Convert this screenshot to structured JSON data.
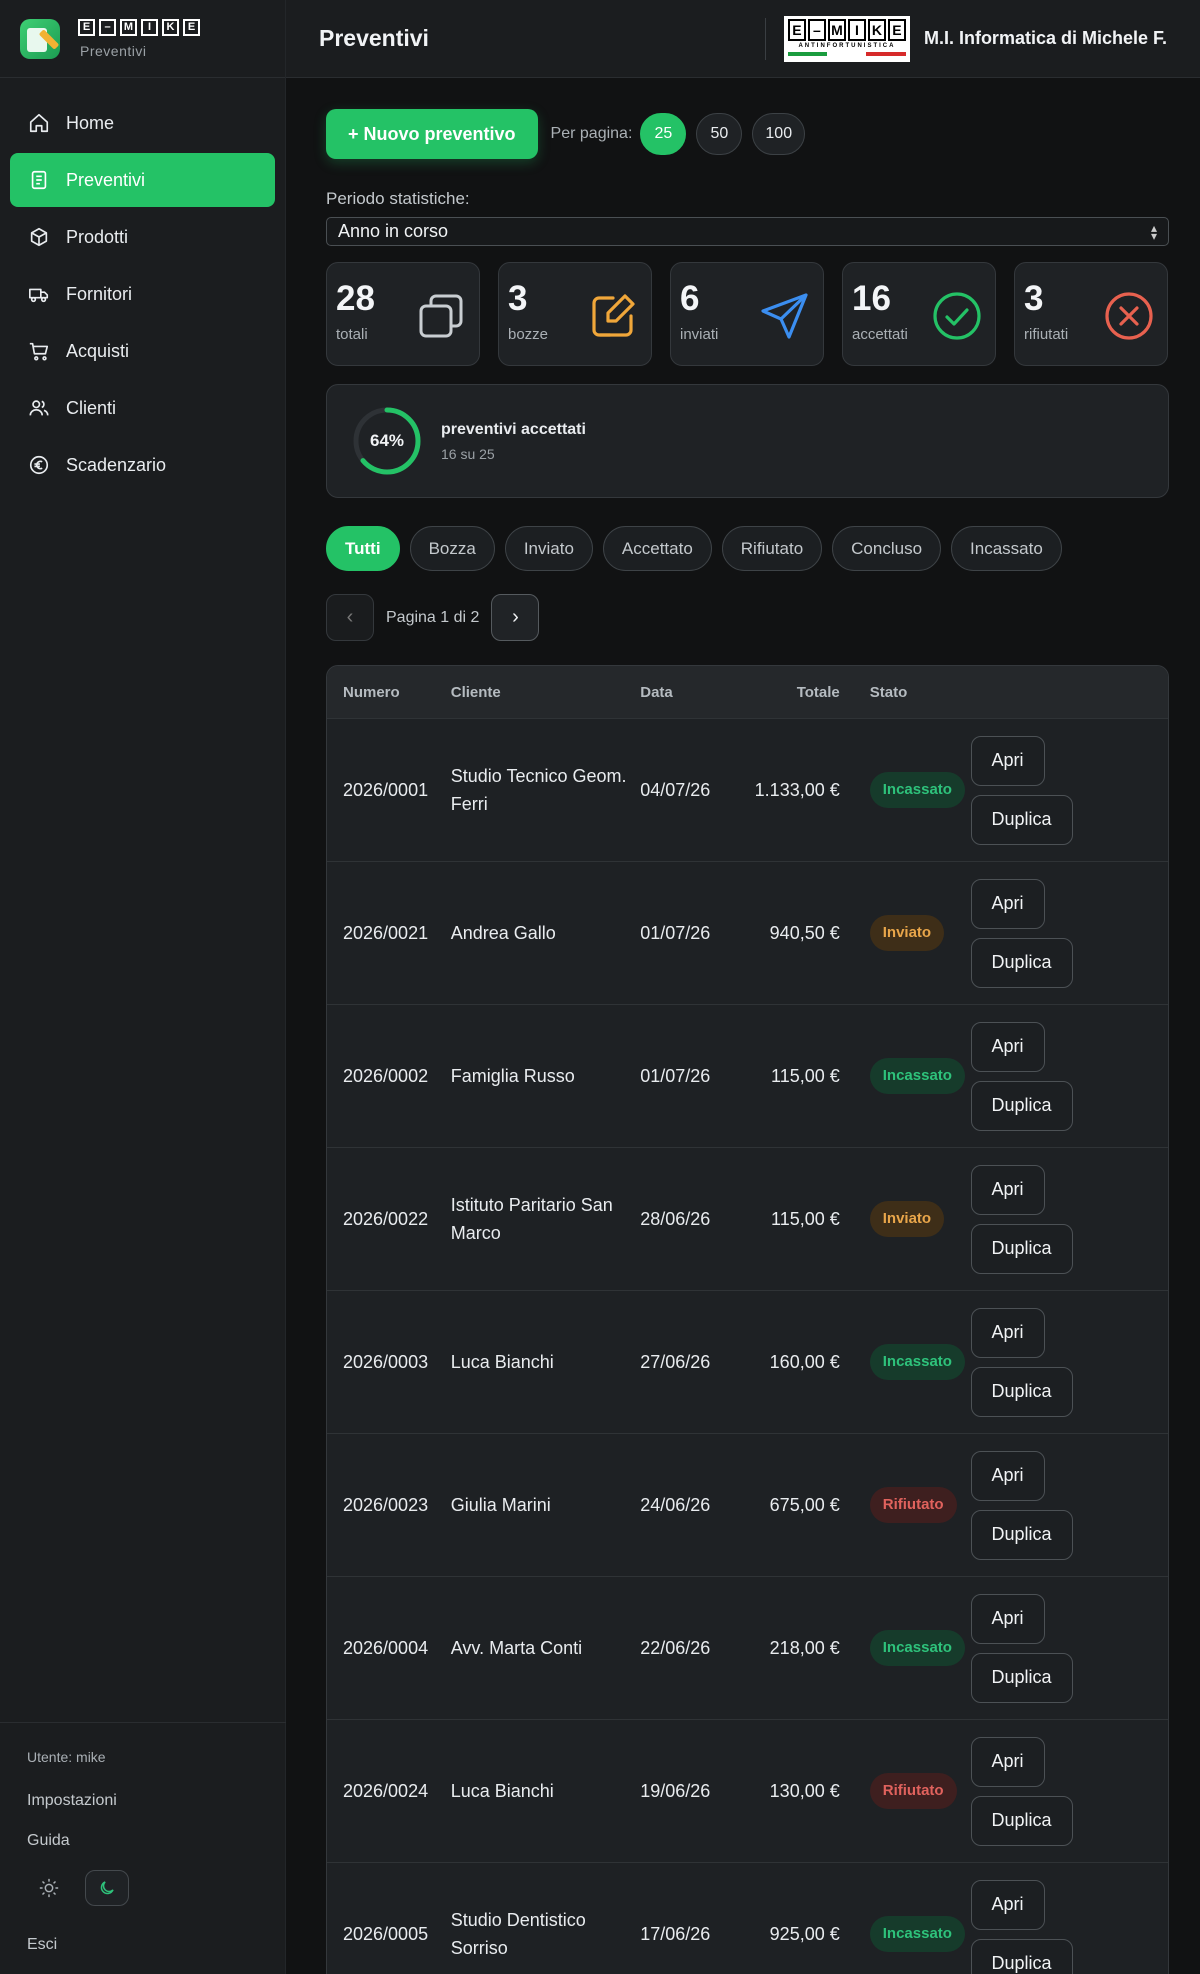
{
  "brand": {
    "logo_letters": [
      "E",
      "–",
      "M",
      "I",
      "K",
      "E"
    ],
    "app_name": "Preventivi"
  },
  "nav": [
    {
      "label": "Home",
      "icon": "home-icon",
      "active": false
    },
    {
      "label": "Preventivi",
      "icon": "document-icon",
      "active": true
    },
    {
      "label": "Prodotti",
      "icon": "box-icon",
      "active": false
    },
    {
      "label": "Fornitori",
      "icon": "truck-icon",
      "active": false
    },
    {
      "label": "Acquisti",
      "icon": "cart-icon",
      "active": false
    },
    {
      "label": "Clienti",
      "icon": "users-icon",
      "active": false
    },
    {
      "label": "Scadenzario",
      "icon": "euro-icon",
      "active": false
    }
  ],
  "footer": {
    "user": "Utente: mike",
    "settings": "Impostazioni",
    "guide": "Guida",
    "logout": "Esci"
  },
  "header": {
    "title": "Preventivi",
    "company_logo_letters": [
      "E",
      "–",
      "M",
      "I",
      "K",
      "E"
    ],
    "company_logo_tagline": "ANTINFORTUNISTICA",
    "company_name": "M.I. Informatica di Michele F."
  },
  "toolbar": {
    "new_label": "+ Nuovo preventivo",
    "per_page_label": "Per pagina:",
    "per_page_options": [
      "25",
      "50",
      "100"
    ],
    "per_page_selected": "25"
  },
  "period": {
    "label": "Periodo statistiche:",
    "value": "Anno in corso"
  },
  "stats": [
    {
      "value": "28",
      "label": "totali",
      "icon": "copy-icon",
      "color": "#c9ced2"
    },
    {
      "value": "3",
      "label": "bozze",
      "icon": "edit-icon",
      "color": "#f0a73a"
    },
    {
      "value": "6",
      "label": "inviati",
      "icon": "send-icon",
      "color": "#3b8ef0"
    },
    {
      "value": "16",
      "label": "accettati",
      "icon": "check-circle-icon",
      "color": "#24c266"
    },
    {
      "value": "3",
      "label": "rifiutati",
      "icon": "x-circle-icon",
      "color": "#e8614f"
    }
  ],
  "progress": {
    "percent": 64,
    "percent_label": "64%",
    "title": "preventivi accettati",
    "subtitle": "16 su 25",
    "color": "#24c266"
  },
  "filters": [
    "Tutti",
    "Bozza",
    "Inviato",
    "Accettato",
    "Rifiutato",
    "Concluso",
    "Incassato"
  ],
  "active_filter": "Tutti",
  "pager": {
    "label": "Pagina 1 di 2"
  },
  "table": {
    "columns": {
      "numero": "Numero",
      "cliente": "Cliente",
      "data": "Data",
      "totale": "Totale",
      "stato": "Stato"
    },
    "open_label": "Apri",
    "duplicate_label": "Duplica",
    "rows": [
      {
        "numero": "2026/0001",
        "cliente": "Studio Tecnico Geom. Ferri",
        "data": "04/07/26",
        "totale": "1.133,00 €",
        "stato": "Incassato"
      },
      {
        "numero": "2026/0021",
        "cliente": "Andrea Gallo",
        "data": "01/07/26",
        "totale": "940,50 €",
        "stato": "Inviato"
      },
      {
        "numero": "2026/0002",
        "cliente": "Famiglia Russo",
        "data": "01/07/26",
        "totale": "115,00 €",
        "stato": "Incassato"
      },
      {
        "numero": "2026/0022",
        "cliente": "Istituto Paritario San Marco",
        "data": "28/06/26",
        "totale": "115,00 €",
        "stato": "Inviato"
      },
      {
        "numero": "2026/0003",
        "cliente": "Luca Bianchi",
        "data": "27/06/26",
        "totale": "160,00 €",
        "stato": "Incassato"
      },
      {
        "numero": "2026/0023",
        "cliente": "Giulia Marini",
        "data": "24/06/26",
        "totale": "675,00 €",
        "stato": "Rifiutato"
      },
      {
        "numero": "2026/0004",
        "cliente": "Avv. Marta Conti",
        "data": "22/06/26",
        "totale": "218,00 €",
        "stato": "Incassato"
      },
      {
        "numero": "2026/0024",
        "cliente": "Luca Bianchi",
        "data": "19/06/26",
        "totale": "130,00 €",
        "stato": "Rifiutato"
      },
      {
        "numero": "2026/0005",
        "cliente": "Studio Dentistico Sorriso",
        "data": "17/06/26",
        "totale": "925,00 €",
        "stato": "Incassato"
      }
    ]
  }
}
